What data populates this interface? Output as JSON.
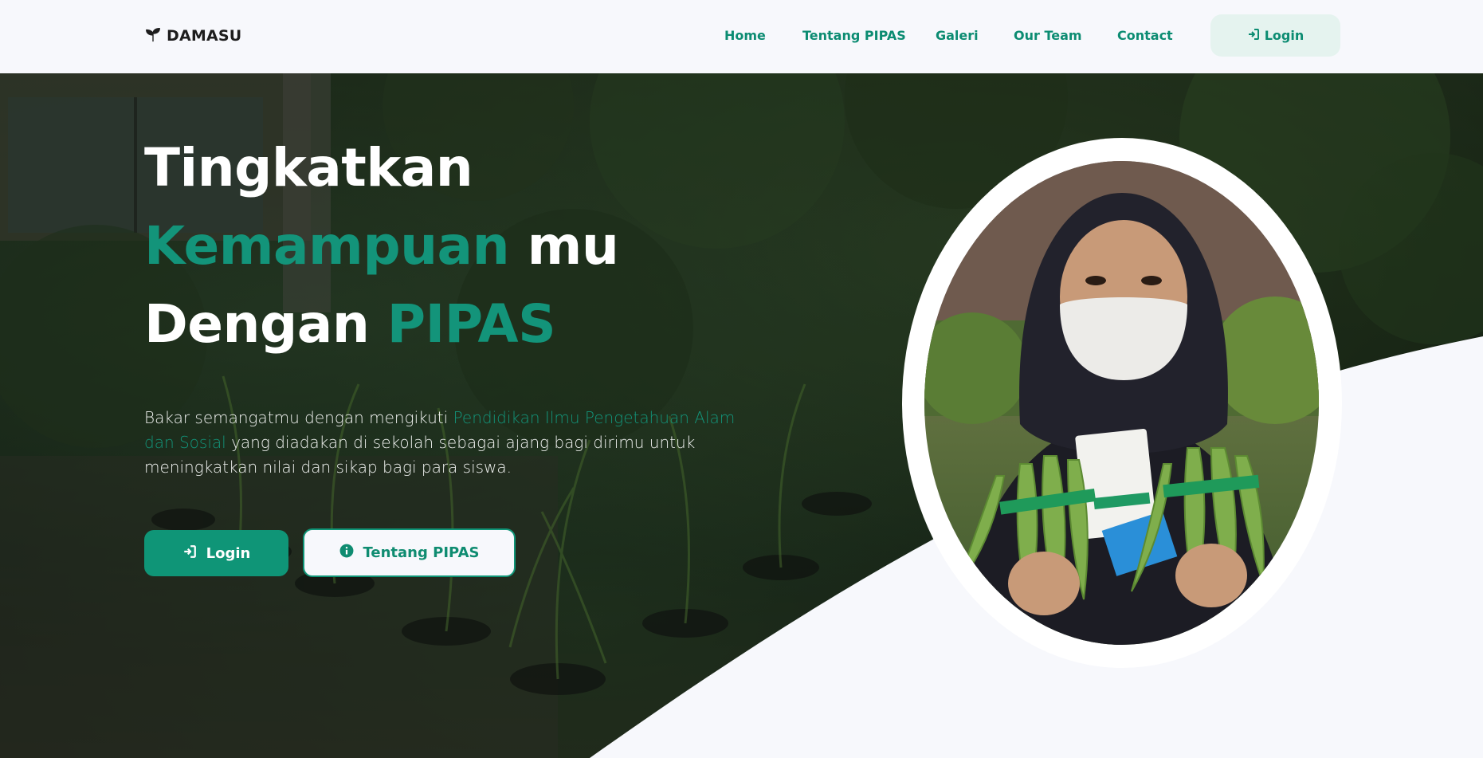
{
  "brand": {
    "name": "DAMASU",
    "icon": "seedling-icon"
  },
  "nav": {
    "links": [
      "Home",
      "Tentang PIPAS",
      "Galeri",
      "Our Team",
      "Contact"
    ],
    "login_label": "Login",
    "login_icon": "sign-in-icon"
  },
  "hero": {
    "title_line1": "Tingkatkan",
    "title_line2_accent": "Kemampuan",
    "title_line2_rest": " mu",
    "title_line3_plain": "Dengan ",
    "title_line3_accent": "PIPAS",
    "desc_before": "Bakar semangatmu dengan mengikuti ",
    "desc_accent": "Pendidikan Ilmu Pengetahuan Alam dan Sosial",
    "desc_after": " yang diadakan di sekolah sebagai ajang bagi dirimu untuk meningkatkan nilai dan sikap bagi para siswa.",
    "primary_button": "Login",
    "primary_icon": "sign-in-icon",
    "secondary_button": "Tentang PIPAS",
    "secondary_icon": "info-circle-icon"
  },
  "colors": {
    "accent": "#13947a",
    "nav_text": "#0c8c72",
    "background": "#f7f8fc"
  }
}
